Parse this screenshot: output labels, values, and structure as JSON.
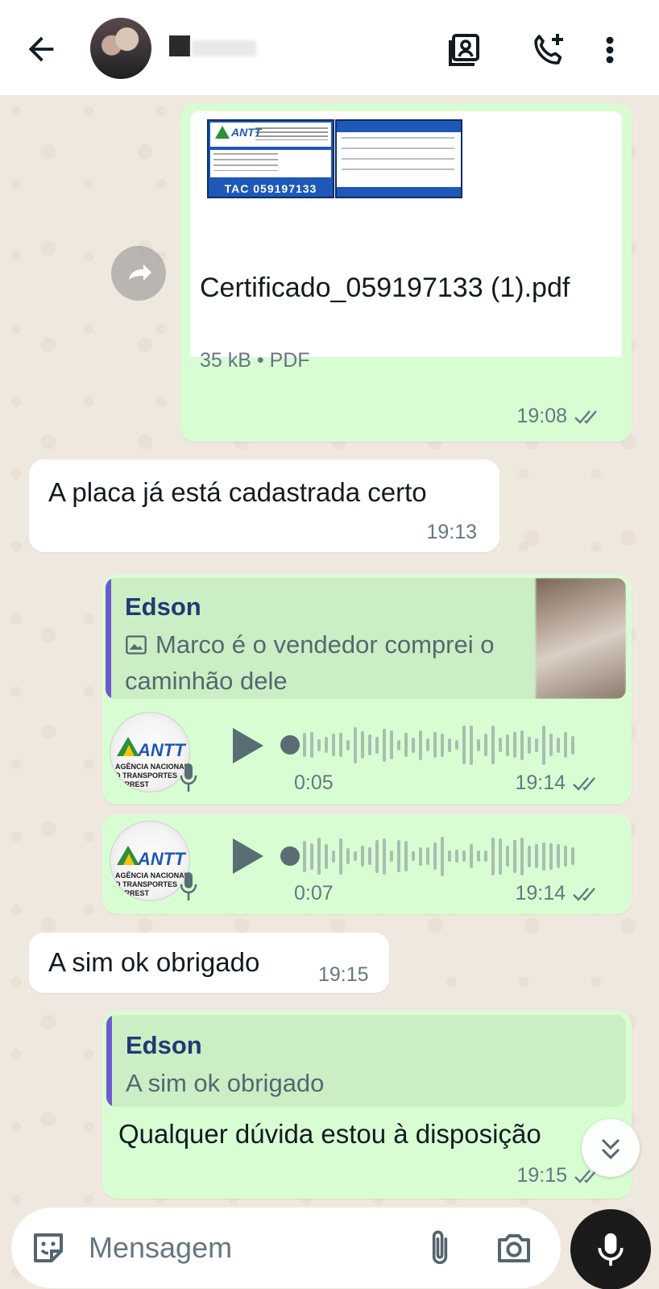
{
  "header": {
    "contact_name": "",
    "icons": [
      "back-arrow-icon",
      "contact-card-icon",
      "add-call-icon",
      "more-vert-icon"
    ]
  },
  "messages": {
    "document": {
      "file_name": "Certificado_059197133 (1).pdf",
      "meta": "35 kB • PDF",
      "time": "19:08",
      "thumb": {
        "logo": "ANTT",
        "tac": "TAC  059197133"
      }
    },
    "incoming1": {
      "text": "A placa já está cadastrada certo",
      "time": "19:13"
    },
    "reply1": {
      "quote_author": "Edson",
      "quote_text": "Marco é o vendedor comprei o caminhão dele",
      "audio_duration": "0:05",
      "time": "19:14",
      "avatar_brand": "ANTT",
      "avatar_sub": "AGÊNCIA NACIONAL D TRANSPORTES TERREST"
    },
    "audio2": {
      "audio_duration": "0:07",
      "time": "19:14",
      "avatar_brand": "ANTT",
      "avatar_sub": "AGÊNCIA NACIONAL D TRANSPORTES TERREST"
    },
    "incoming2": {
      "text": "A sim ok obrigado",
      "time": "19:15"
    },
    "reply2": {
      "quote_author": "Edson",
      "quote_text": "A sim ok obrigado",
      "text": "Qualquer dúvida estou à disposição",
      "time": "19:15"
    }
  },
  "composer": {
    "placeholder": "Mensagem"
  },
  "colors": {
    "outgoing_bubble": "#d9fdd3",
    "incoming_bubble": "#ffffff",
    "quote_bar": "#6b5bd1",
    "quote_author": "#1f3a74",
    "read_ticks": "#667781"
  }
}
